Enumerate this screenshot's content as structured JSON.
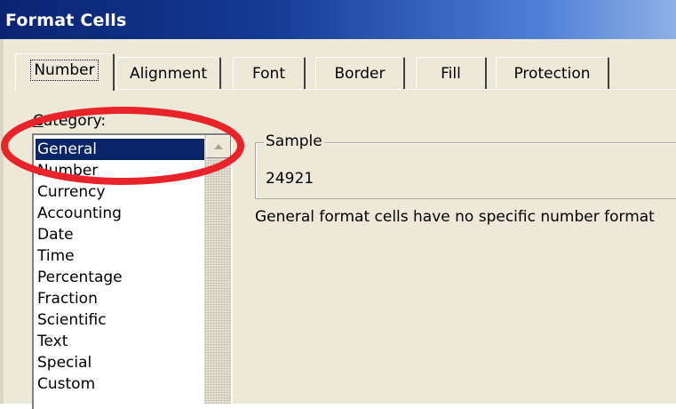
{
  "window": {
    "title": "Format Cells"
  },
  "tabs": [
    {
      "label": "Number",
      "active": true
    },
    {
      "label": "Alignment",
      "active": false
    },
    {
      "label": "Font",
      "active": false
    },
    {
      "label": "Border",
      "active": false
    },
    {
      "label": "Fill",
      "active": false
    },
    {
      "label": "Protection",
      "active": false
    }
  ],
  "category": {
    "label_mnemonic": "C",
    "label_rest": "ategory:",
    "items": [
      "General",
      "Number",
      "Currency",
      "Accounting",
      "Date",
      "Time",
      "Percentage",
      "Fraction",
      "Scientific",
      "Text",
      "Special",
      "Custom"
    ],
    "selected": "General"
  },
  "sample": {
    "group_label": "Sample",
    "value": "24921"
  },
  "description": "General format cells have no specific number format",
  "annotation": {
    "color": "#e8232a",
    "shape": "ellipse",
    "target": "General"
  },
  "colors": {
    "titlebar_start": "#0a2472",
    "titlebar_end": "#8fb0e6",
    "selection": "#0a246a",
    "dialog_bg": "#ece9d8"
  }
}
